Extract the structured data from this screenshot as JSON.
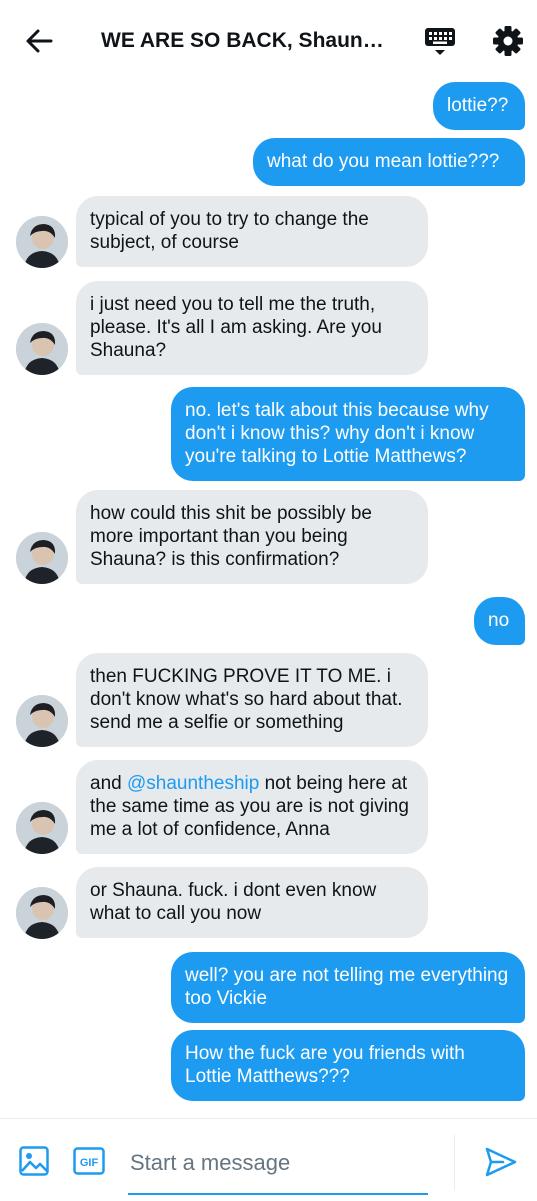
{
  "header": {
    "title": "WE ARE SO BACK, Shaun…"
  },
  "colors": {
    "accent": "#1d9bf0",
    "received_bubble": "#e7eaed",
    "text": "#0f1419"
  },
  "messages": [
    {
      "side": "sent",
      "text": "lottie??"
    },
    {
      "side": "sent",
      "text": "what do you mean lottie???"
    },
    {
      "side": "received",
      "text": "typical of you to try to change the subject, of course"
    },
    {
      "side": "received",
      "text": "i just need you to tell me the truth, please. It's all I am asking. Are you Shauna?"
    },
    {
      "side": "sent",
      "text": "no. let's talk about this because why don't i know this? why don't i know you're talking to Lottie Matthews?"
    },
    {
      "side": "received",
      "text": "how could this shit be possibly be more important than you being Shauna? is this confirmation?"
    },
    {
      "side": "sent",
      "text": "no"
    },
    {
      "side": "received",
      "text": "then FUCKING PROVE IT TO ME. i don't know what's so hard about that. send me a selfie or something"
    },
    {
      "side": "received",
      "prefix": "and ",
      "mention": "@shauntheship",
      "suffix": " not being here at the same time as you are is not giving me a lot of confidence, Anna"
    },
    {
      "side": "received",
      "text": "or Shauna. fuck. i dont even know what to call you now"
    },
    {
      "side": "sent",
      "text": "well? you are not telling me everything too  Vickie"
    },
    {
      "side": "sent",
      "text": "How the fuck are you friends with Lottie Matthews???"
    }
  ],
  "composer": {
    "placeholder": "Start a message",
    "value": "",
    "gif_label": "GIF"
  },
  "icons": {
    "back": "arrow-left-icon",
    "keyboard": "keyboard-icon",
    "settings": "gear-icon",
    "image": "image-icon",
    "gif": "gif-icon",
    "send": "send-icon"
  }
}
